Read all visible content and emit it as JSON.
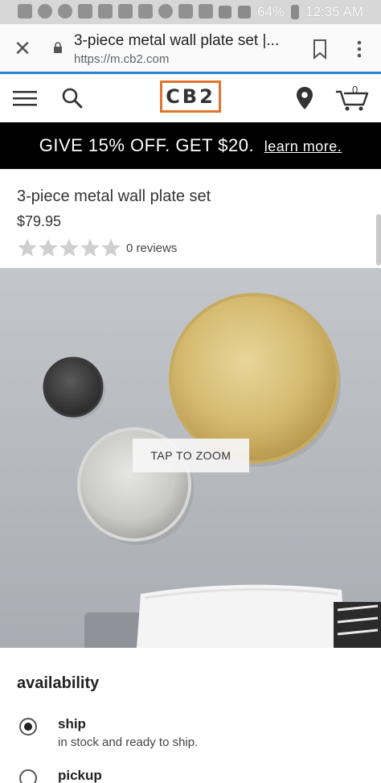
{
  "status_bar": {
    "battery": "64%",
    "time": "12:35 AM"
  },
  "browser": {
    "page_title": "3-piece metal wall plate set |...",
    "url": "https://m.cb2.com"
  },
  "header": {
    "logo": "CB2",
    "cart_count": "0"
  },
  "promo": {
    "text": "GIVE 15% OFF. GET $20.",
    "link": "learn more."
  },
  "product": {
    "title": "3-piece metal wall plate set",
    "price": "$79.95",
    "rating_stars": 0,
    "rating_max": 5,
    "reviews": "0 reviews",
    "zoom_label": "TAP TO ZOOM"
  },
  "availability": {
    "heading": "availability",
    "options": [
      {
        "label": "ship",
        "sub": "in stock and ready to ship.",
        "selected": true
      },
      {
        "label": "pickup",
        "sub": "",
        "selected": false
      }
    ]
  },
  "colors": {
    "accent": "#e0762e",
    "progress_blue": "#2f7fd6",
    "banner_bg": "#000000",
    "star_empty": "#cfcfcf"
  }
}
